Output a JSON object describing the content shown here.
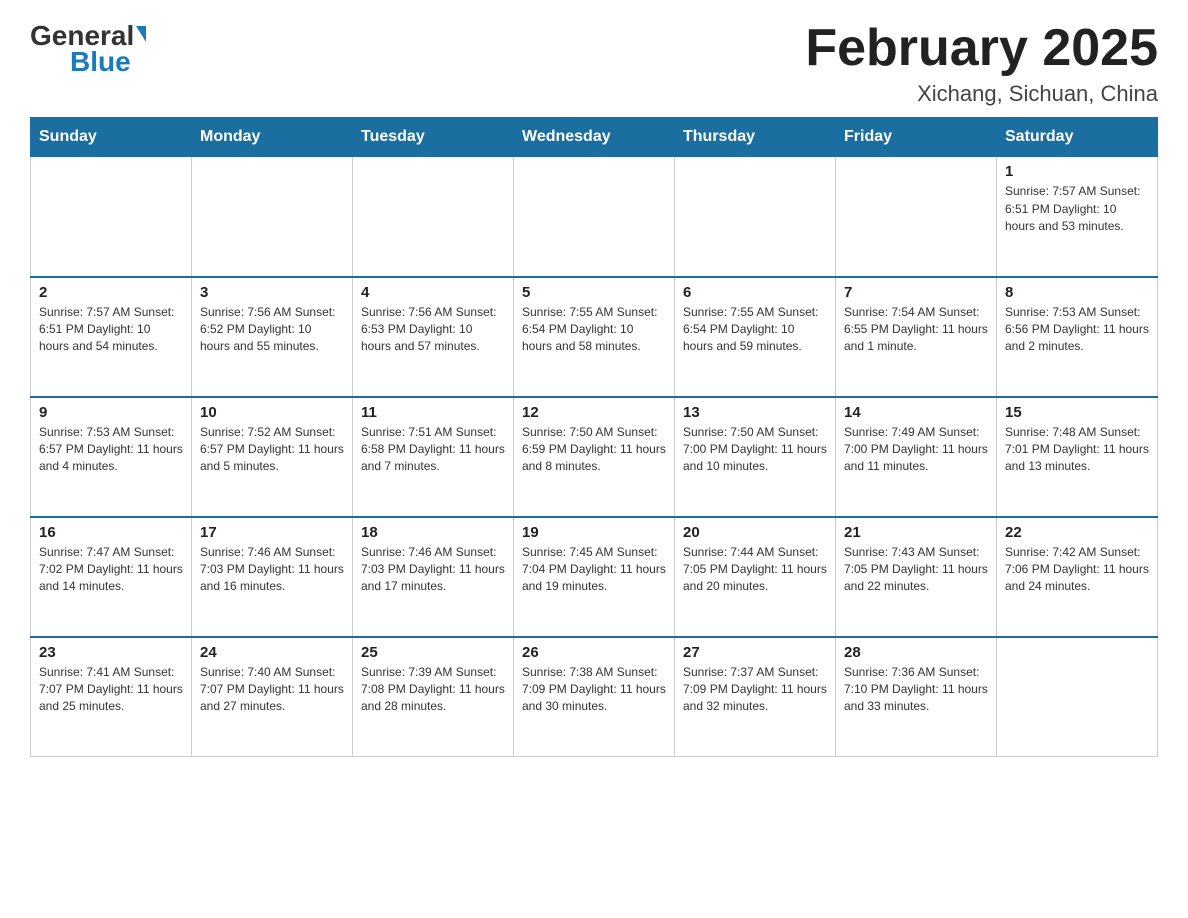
{
  "header": {
    "logo_general": "General",
    "logo_blue": "Blue",
    "month_year": "February 2025",
    "location": "Xichang, Sichuan, China"
  },
  "days_of_week": [
    "Sunday",
    "Monday",
    "Tuesday",
    "Wednesday",
    "Thursday",
    "Friday",
    "Saturday"
  ],
  "weeks": [
    [
      {
        "day": "",
        "info": ""
      },
      {
        "day": "",
        "info": ""
      },
      {
        "day": "",
        "info": ""
      },
      {
        "day": "",
        "info": ""
      },
      {
        "day": "",
        "info": ""
      },
      {
        "day": "",
        "info": ""
      },
      {
        "day": "1",
        "info": "Sunrise: 7:57 AM\nSunset: 6:51 PM\nDaylight: 10 hours\nand 53 minutes."
      }
    ],
    [
      {
        "day": "2",
        "info": "Sunrise: 7:57 AM\nSunset: 6:51 PM\nDaylight: 10 hours\nand 54 minutes."
      },
      {
        "day": "3",
        "info": "Sunrise: 7:56 AM\nSunset: 6:52 PM\nDaylight: 10 hours\nand 55 minutes."
      },
      {
        "day": "4",
        "info": "Sunrise: 7:56 AM\nSunset: 6:53 PM\nDaylight: 10 hours\nand 57 minutes."
      },
      {
        "day": "5",
        "info": "Sunrise: 7:55 AM\nSunset: 6:54 PM\nDaylight: 10 hours\nand 58 minutes."
      },
      {
        "day": "6",
        "info": "Sunrise: 7:55 AM\nSunset: 6:54 PM\nDaylight: 10 hours\nand 59 minutes."
      },
      {
        "day": "7",
        "info": "Sunrise: 7:54 AM\nSunset: 6:55 PM\nDaylight: 11 hours\nand 1 minute."
      },
      {
        "day": "8",
        "info": "Sunrise: 7:53 AM\nSunset: 6:56 PM\nDaylight: 11 hours\nand 2 minutes."
      }
    ],
    [
      {
        "day": "9",
        "info": "Sunrise: 7:53 AM\nSunset: 6:57 PM\nDaylight: 11 hours\nand 4 minutes."
      },
      {
        "day": "10",
        "info": "Sunrise: 7:52 AM\nSunset: 6:57 PM\nDaylight: 11 hours\nand 5 minutes."
      },
      {
        "day": "11",
        "info": "Sunrise: 7:51 AM\nSunset: 6:58 PM\nDaylight: 11 hours\nand 7 minutes."
      },
      {
        "day": "12",
        "info": "Sunrise: 7:50 AM\nSunset: 6:59 PM\nDaylight: 11 hours\nand 8 minutes."
      },
      {
        "day": "13",
        "info": "Sunrise: 7:50 AM\nSunset: 7:00 PM\nDaylight: 11 hours\nand 10 minutes."
      },
      {
        "day": "14",
        "info": "Sunrise: 7:49 AM\nSunset: 7:00 PM\nDaylight: 11 hours\nand 11 minutes."
      },
      {
        "day": "15",
        "info": "Sunrise: 7:48 AM\nSunset: 7:01 PM\nDaylight: 11 hours\nand 13 minutes."
      }
    ],
    [
      {
        "day": "16",
        "info": "Sunrise: 7:47 AM\nSunset: 7:02 PM\nDaylight: 11 hours\nand 14 minutes."
      },
      {
        "day": "17",
        "info": "Sunrise: 7:46 AM\nSunset: 7:03 PM\nDaylight: 11 hours\nand 16 minutes."
      },
      {
        "day": "18",
        "info": "Sunrise: 7:46 AM\nSunset: 7:03 PM\nDaylight: 11 hours\nand 17 minutes."
      },
      {
        "day": "19",
        "info": "Sunrise: 7:45 AM\nSunset: 7:04 PM\nDaylight: 11 hours\nand 19 minutes."
      },
      {
        "day": "20",
        "info": "Sunrise: 7:44 AM\nSunset: 7:05 PM\nDaylight: 11 hours\nand 20 minutes."
      },
      {
        "day": "21",
        "info": "Sunrise: 7:43 AM\nSunset: 7:05 PM\nDaylight: 11 hours\nand 22 minutes."
      },
      {
        "day": "22",
        "info": "Sunrise: 7:42 AM\nSunset: 7:06 PM\nDaylight: 11 hours\nand 24 minutes."
      }
    ],
    [
      {
        "day": "23",
        "info": "Sunrise: 7:41 AM\nSunset: 7:07 PM\nDaylight: 11 hours\nand 25 minutes."
      },
      {
        "day": "24",
        "info": "Sunrise: 7:40 AM\nSunset: 7:07 PM\nDaylight: 11 hours\nand 27 minutes."
      },
      {
        "day": "25",
        "info": "Sunrise: 7:39 AM\nSunset: 7:08 PM\nDaylight: 11 hours\nand 28 minutes."
      },
      {
        "day": "26",
        "info": "Sunrise: 7:38 AM\nSunset: 7:09 PM\nDaylight: 11 hours\nand 30 minutes."
      },
      {
        "day": "27",
        "info": "Sunrise: 7:37 AM\nSunset: 7:09 PM\nDaylight: 11 hours\nand 32 minutes."
      },
      {
        "day": "28",
        "info": "Sunrise: 7:36 AM\nSunset: 7:10 PM\nDaylight: 11 hours\nand 33 minutes."
      },
      {
        "day": "",
        "info": ""
      }
    ]
  ]
}
